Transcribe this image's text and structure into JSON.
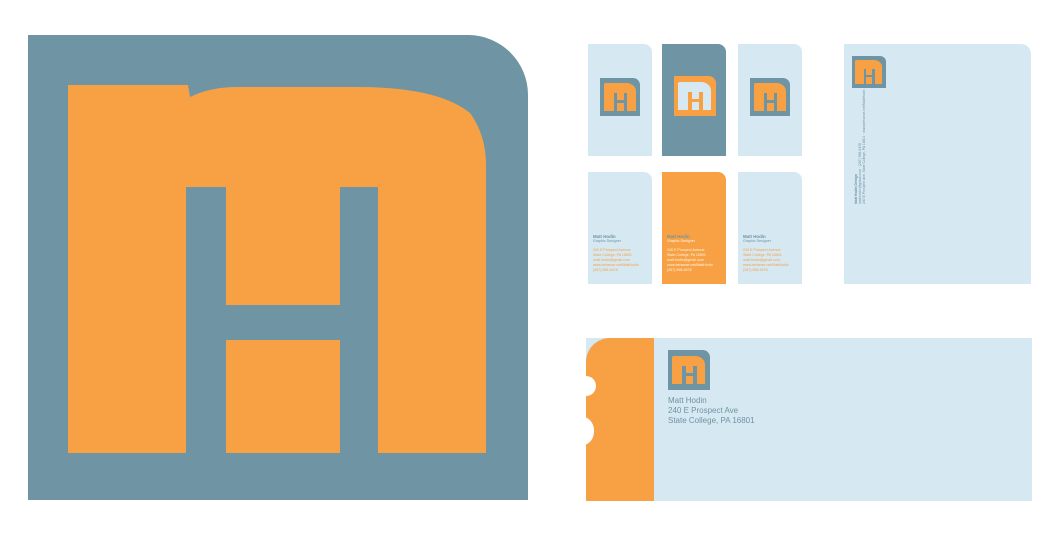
{
  "colors": {
    "orange": "#f7a144",
    "slate": "#6f94a3",
    "light": "#d6e8f2"
  },
  "business_cards": [
    {
      "name": "Matt Hodin",
      "title": "Graphic Designer",
      "address_1": "240 E Prospect Avenue",
      "address_2": "State College, PA 16801",
      "email": "matt.hodin@gmail.com",
      "web": "www.behance.net/MattHodin",
      "phone": "(267) 558-5478"
    },
    {
      "name": "Matt Hodin",
      "title": "Graphic Designer",
      "address_1": "240 E Prospect Avenue",
      "address_2": "State College, PA 16801",
      "email": "matt.hodin@gmail.com",
      "web": "www.behance.net/MattHodin",
      "phone": "(267) 558-5478"
    },
    {
      "name": "Matt Hodin",
      "title": "Graphic Designer",
      "address_1": "240 E Prospect Avenue",
      "address_2": "State College, PA 16801",
      "email": "matt.hodin@gmail.com",
      "web": "www.behance.net/MattHodin",
      "phone": "(267) 558-5478"
    }
  ],
  "letterhead": {
    "line_1": "Matt Hodin Design",
    "line_2": "matt.hodin@gmail.com  ·  (267) 558-5478",
    "line_3": "240 E Prospect Ave, State College, PA 16801  ·  www.behance.net/MattHodin"
  },
  "envelope": {
    "name": "Matt Hodin",
    "street": "240 E Prospect Ave",
    "city": "State College, PA 16801"
  }
}
